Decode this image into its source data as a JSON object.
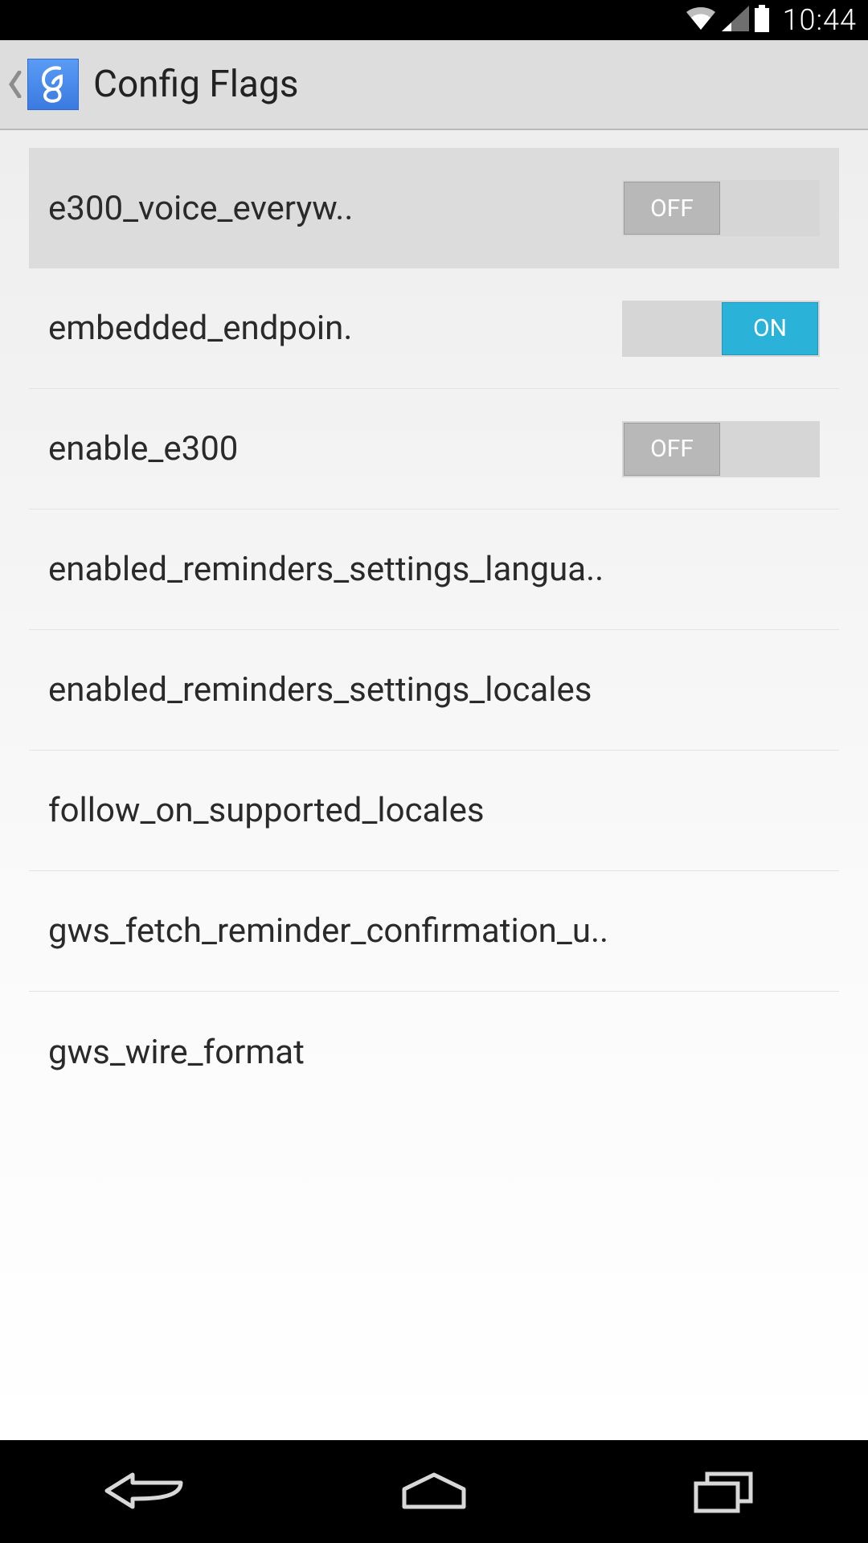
{
  "status": {
    "time": "10:44"
  },
  "header": {
    "title": "Config Flags"
  },
  "toggle_labels": {
    "on": "ON",
    "off": "OFF"
  },
  "rows": [
    {
      "label": "e300_voice_everyw",
      "truncated": true,
      "selected": true,
      "toggle": "off"
    },
    {
      "label": "embedded_endpoin",
      "truncated": true,
      "selected": false,
      "toggle": "on"
    },
    {
      "label": "enable_e300",
      "truncated": false,
      "selected": false,
      "toggle": "off"
    },
    {
      "label": "enabled_reminders_settings_langua",
      "truncated": true,
      "selected": false,
      "toggle": null
    },
    {
      "label": "enabled_reminders_settings_locales",
      "truncated": false,
      "selected": false,
      "toggle": null
    },
    {
      "label": "follow_on_supported_locales",
      "truncated": false,
      "selected": false,
      "toggle": null
    },
    {
      "label": "gws_fetch_reminder_confirmation_u",
      "truncated": true,
      "selected": false,
      "toggle": null
    },
    {
      "label": "gws_wire_format",
      "truncated": false,
      "selected": false,
      "toggle": null
    }
  ]
}
